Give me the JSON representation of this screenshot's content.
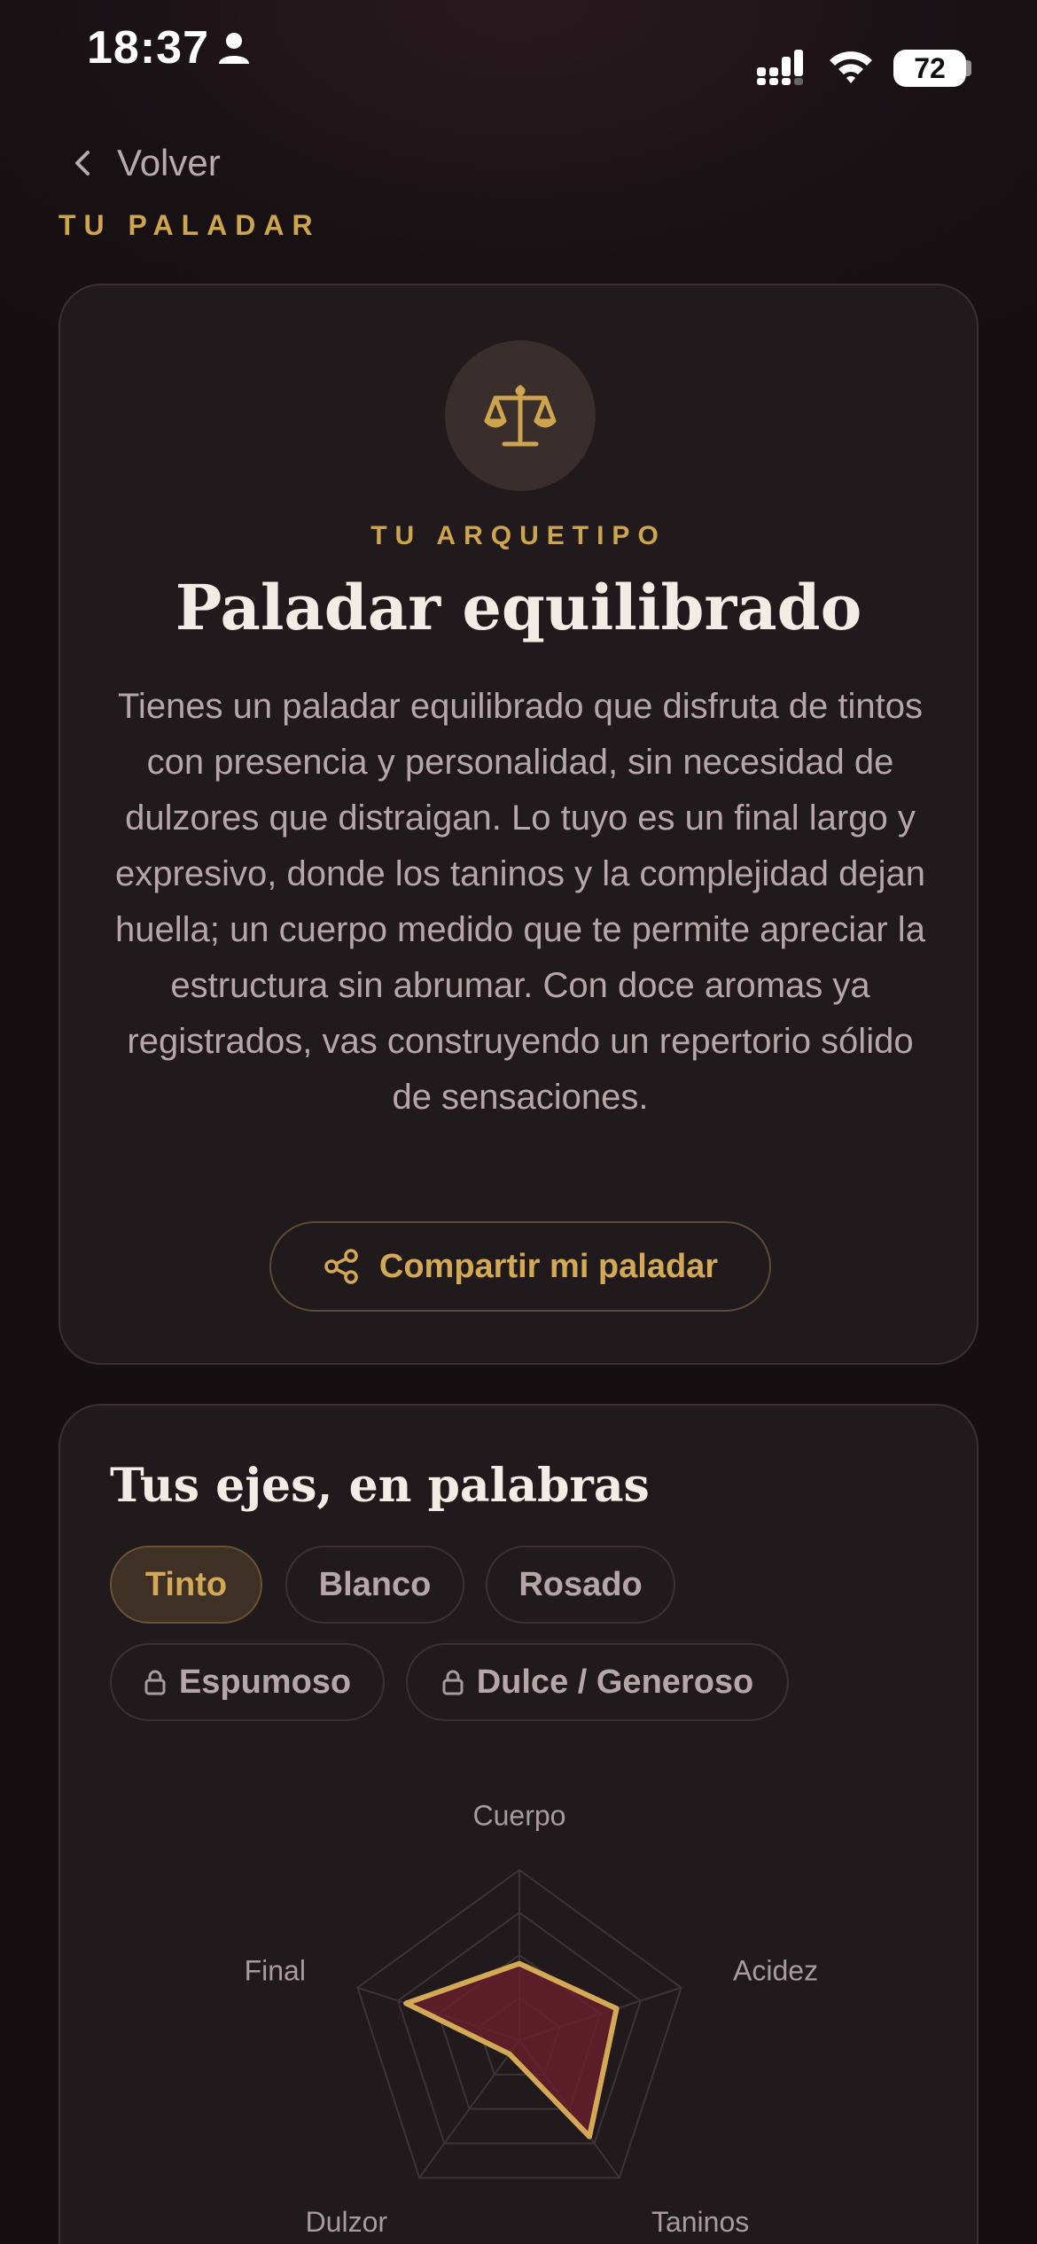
{
  "status_bar": {
    "time": "18:37",
    "battery": "72"
  },
  "header": {
    "back_label": "Volver",
    "eyebrow": "TU PALADAR"
  },
  "archetype": {
    "eyebrow": "TU ARQUETIPO",
    "title": "Paladar equilibrado",
    "description": "Tienes un paladar equilibrado que disfruta de tintos con presencia y personalidad, sin necesidad de dulzores que distraigan. Lo tuyo es un final largo y expresivo, donde los taninos y la complejidad dejan huella; un cuerpo medido que te permite apreciar la estructura sin abrumar. Con doce aromas ya registrados, vas construyendo un repertorio sólido de sensaciones.",
    "share_label": "Compartir mi paladar",
    "icon": "scale-icon"
  },
  "axes": {
    "title": "Tus ejes, en palabras",
    "chips": [
      {
        "label": "Tinto",
        "active": true,
        "locked": false
      },
      {
        "label": "Blanco",
        "active": false,
        "locked": false
      },
      {
        "label": "Rosado",
        "active": false,
        "locked": false
      },
      {
        "label": "Espumoso",
        "active": false,
        "locked": true
      },
      {
        "label": "Dulce / Generoso",
        "active": false,
        "locked": true
      }
    ],
    "radar": {
      "axes": [
        "Cuerpo",
        "Acidez",
        "Taninos",
        "Dulzor",
        "Final"
      ],
      "values": [
        0.45,
        0.6,
        0.7,
        0.1,
        0.7
      ],
      "max": 1,
      "rings": 4,
      "stroke_color": "#d4a955",
      "fill_color": "#6a1e2c"
    }
  },
  "colors": {
    "accent": "#cfa44f",
    "card": "#211a1d",
    "background": "#151113"
  }
}
